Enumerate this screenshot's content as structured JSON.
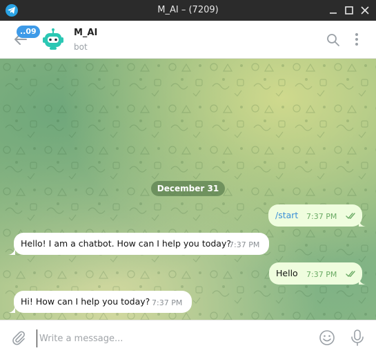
{
  "window": {
    "title": "M_AI – (7209)"
  },
  "header": {
    "unread_count": "..09",
    "chat_name": "M_AI",
    "chat_status": "bot"
  },
  "chat": {
    "date_separator": "December 31",
    "messages": [
      {
        "direction": "outgoing",
        "text": "/start",
        "time": "7:37 PM",
        "read": true
      },
      {
        "direction": "incoming",
        "text": "Hello! I am a chatbot. How can I help you today?",
        "time": "7:37 PM"
      },
      {
        "direction": "outgoing",
        "text": "Hello",
        "time": "7:37 PM",
        "read": true
      },
      {
        "direction": "incoming",
        "text": "Hi! How can I help you today?",
        "time": "7:37 PM"
      }
    ]
  },
  "input": {
    "placeholder": "Write a message...",
    "value": ""
  },
  "colors": {
    "accent": "#3d9ae8",
    "outgoing_bubble": "#effdde",
    "incoming_bubble": "#ffffff",
    "read_check": "#6aaa64",
    "title_bar": "#2b2b2b"
  },
  "icons": [
    "telegram-icon",
    "minimize-icon",
    "maximize-icon",
    "close-icon",
    "back-arrow-icon",
    "bot-avatar",
    "search-icon",
    "more-vertical-icon",
    "double-check-icon",
    "attach-icon",
    "emoji-icon",
    "microphone-icon"
  ]
}
